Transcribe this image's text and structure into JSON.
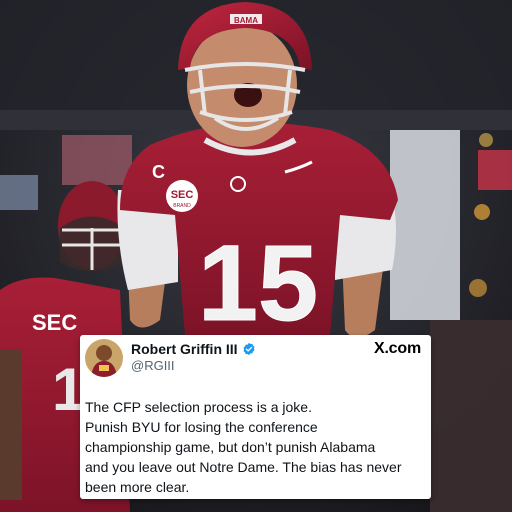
{
  "photo": {
    "jersey_number": "15",
    "captain_patch": "C",
    "helmet_text": "BAMA",
    "patch_text": "SEC",
    "patch_subtext": "BRAND",
    "second_player_number": "1"
  },
  "post": {
    "display_name": "Robert Griffin III",
    "handle": "@RGIII",
    "brand": "X.com",
    "verified_icon": "verified-badge-icon",
    "text_lines": [
      "The CFP selection process is a joke.",
      "Punish BYU for losing the conference",
      "championship game, but don’t punish Alabama",
      "and you leave out Notre Dame. The bias has never",
      "been more clear."
    ]
  },
  "colors": {
    "crimson": "#9e1b32",
    "verified_blue": "#1d9bf0",
    "card_bg": "#ffffff"
  }
}
